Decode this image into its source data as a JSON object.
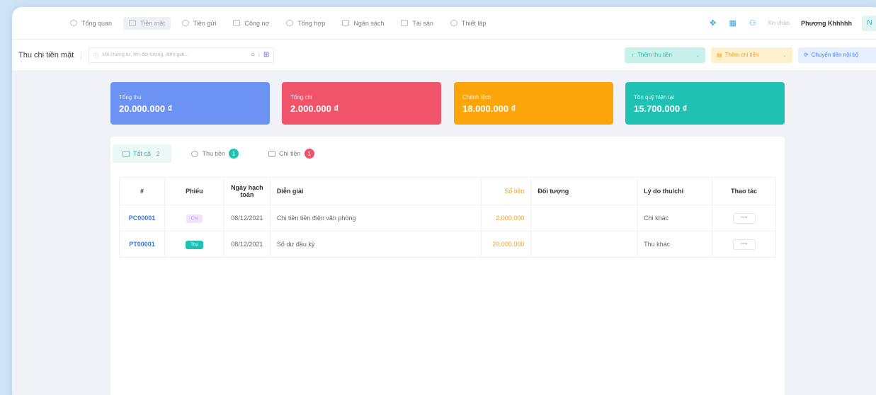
{
  "nav": {
    "items": [
      {
        "label": "Tổng quan",
        "icon": "dashboard-icon"
      },
      {
        "label": "Tiền mặt",
        "icon": "cash-icon"
      },
      {
        "label": "Tiền gửi",
        "icon": "deposit-icon"
      },
      {
        "label": "Công nợ",
        "icon": "debt-icon"
      },
      {
        "label": "Tổng hợp",
        "icon": "summary-icon"
      },
      {
        "label": "Ngân sách",
        "icon": "budget-icon"
      },
      {
        "label": "Tài sản",
        "icon": "asset-icon"
      },
      {
        "label": "Thiết lập",
        "icon": "settings-icon"
      }
    ],
    "active": "Tiền mặt",
    "greeting": "Xin chào,",
    "user_name": "Phương Khhhhh",
    "avatar_initial": "N"
  },
  "toolbar": {
    "title": "Thu chi tiền mặt",
    "search_placeholder": "Mã chứng từ, tên đối tượng, diễn giải...",
    "add_income": "Thêm thu tiền",
    "add_expense": "Thêm chi tiền",
    "transfer": "Chuyển tiền nội bộ"
  },
  "summary": {
    "total_income_label": "Tổng thu",
    "total_income_value": "20.000.000 ₫",
    "total_expense_label": "Tổng chi",
    "total_expense_value": "2.000.000 ₫",
    "difference_label": "Chênh lệch",
    "difference_value": "18.000.000 ₫",
    "fund_label": "Tồn quỹ hiện tại",
    "fund_value": "15.700.000 ₫"
  },
  "tabs": {
    "all_label": "Tất cả",
    "all_count": "2",
    "income_label": "Thu tiền",
    "income_count": "1",
    "expense_label": "Chi tiền",
    "expense_count": "1"
  },
  "table": {
    "headers": {
      "index": "#",
      "voucher": "Phiếu",
      "date": "Ngày hạch toán",
      "description": "Diễn giải",
      "amount": "Số tiền",
      "party": "Đối tượng",
      "reason": "Lý do thu/chi",
      "actions": "Thao tác"
    },
    "rows": [
      {
        "code": "PC00001",
        "type": "Chi",
        "date": "08/12/2021",
        "description": "Chi tiền tiền điện văn phòng",
        "amount": "2.000.000",
        "party": "",
        "reason": "Chi khác",
        "action": "•••▾"
      },
      {
        "code": "PT00001",
        "type": "Thu",
        "date": "08/12/2021",
        "description": "Số dư đầu kỳ",
        "amount": "20.000.000",
        "party": "",
        "reason": "Thu khác",
        "action": "•••▾"
      }
    ]
  },
  "colors": {
    "income_card": "#6c93f3",
    "expense_card": "#f0546a",
    "difference_card": "#fca50b",
    "fund_card": "#1fc1b2",
    "amount_text": "#f3a321",
    "code_text": "#3a78d8"
  }
}
